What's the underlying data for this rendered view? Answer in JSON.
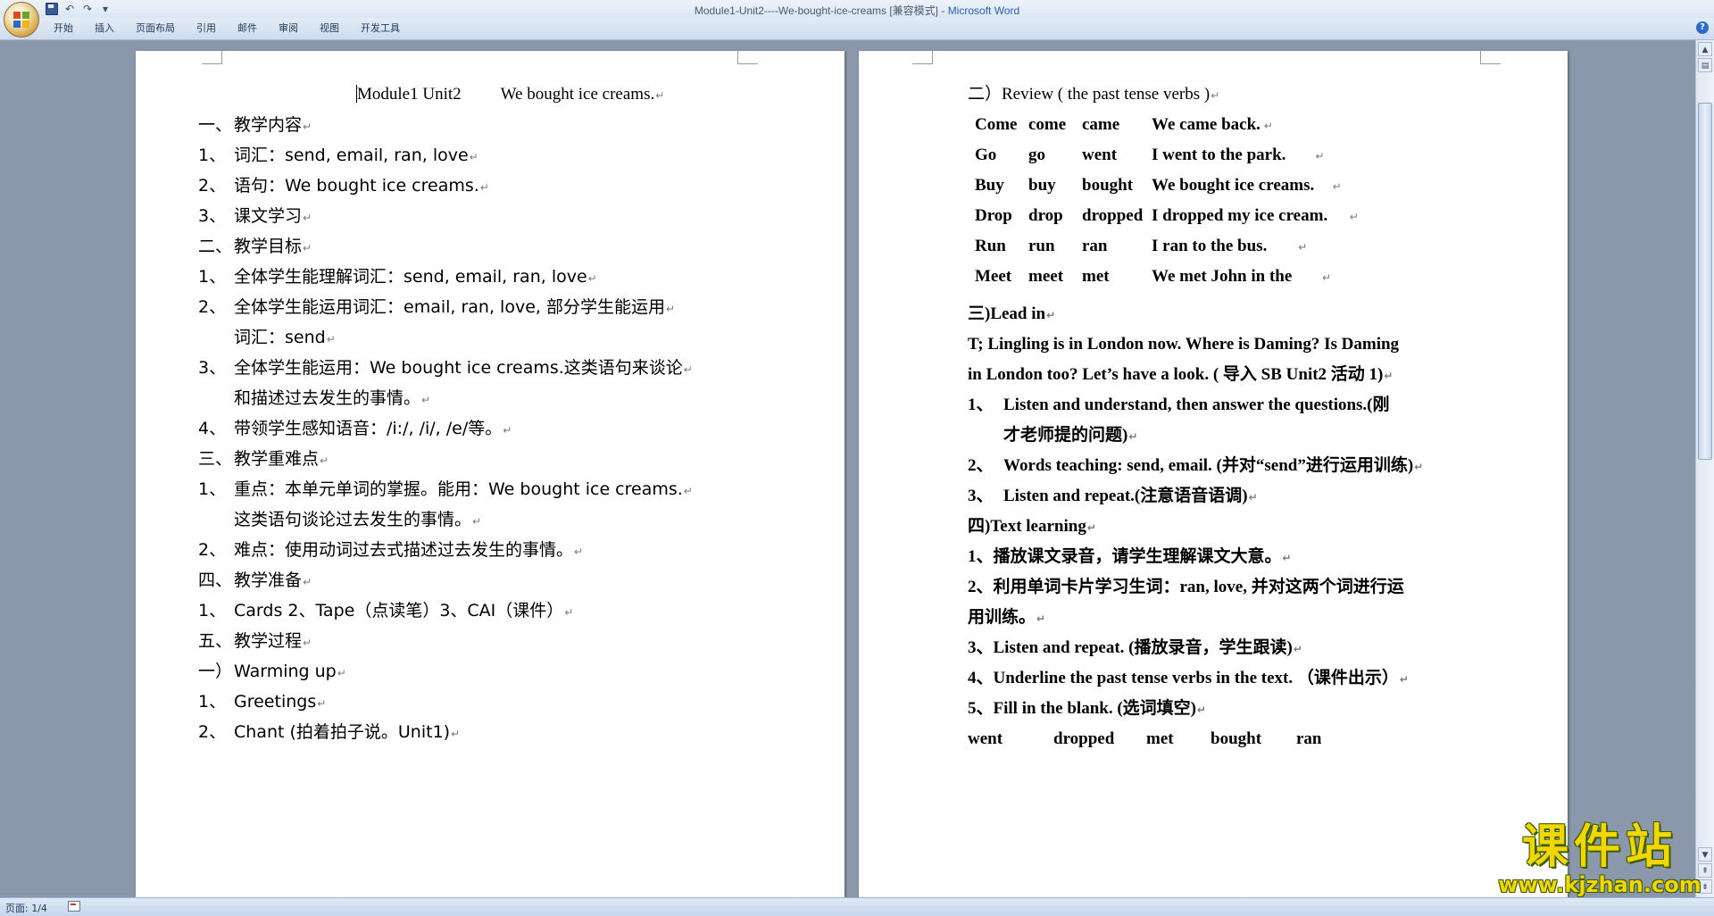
{
  "window": {
    "title_doc": "Module1-Unit2----We-bought-ice-creams [兼容模式] - ",
    "title_app": "Microsoft Word"
  },
  "quick_access": {
    "save_icon": "save-icon",
    "undo_glyph": "↶",
    "redo_glyph": "↷",
    "customize_glyph": "▾"
  },
  "ribbon": {
    "tabs": [
      "开始",
      "插入",
      "页面布局",
      "引用",
      "邮件",
      "审阅",
      "视图",
      "开发工具"
    ],
    "help_glyph": "?"
  },
  "page1": {
    "title_a": "Module1 Unit2",
    "title_b": "We bought ice creams.",
    "lines": [
      {
        "num": "一、",
        "text": "教学内容"
      },
      {
        "num": "1、",
        "text": "词汇：send, email, ran, love"
      },
      {
        "num": "2、",
        "text": "语句：We bought ice creams."
      },
      {
        "num": "3、",
        "text": "课文学习"
      },
      {
        "num": "二、",
        "text": "教学目标"
      },
      {
        "num": "1、",
        "text": "全体学生能理解词汇：send,  email, ran, love"
      },
      {
        "num": "2、",
        "text": "全体学生能运用词汇：email, ran, love,  部分学生能运用"
      },
      {
        "num": "",
        "text": "词汇：send"
      },
      {
        "num": "3、",
        "text": "全体学生能运用：We bought ice creams.这类语句来谈论"
      },
      {
        "num": "",
        "text": "和描述过去发生的事情。"
      },
      {
        "num": "4、",
        "text": "带领学生感知语音：/i:/, /i/, /e/等。"
      },
      {
        "num": "三、",
        "text": "教学重难点"
      },
      {
        "num": "1、",
        "text": "重点：本单元单词的掌握。能用：We bought ice creams."
      },
      {
        "num": "",
        "text": "这类语句谈论过去发生的事情。"
      },
      {
        "num": "2、",
        "text": "难点：使用动词过去式描述过去发生的事情。"
      },
      {
        "num": "四、",
        "text": "教学准备"
      },
      {
        "num": "1、",
        "text": "Cards    2、Tape（点读笔）3、CAI（课件）"
      },
      {
        "num": "五、",
        "text": "教学过程"
      },
      {
        "num": "一）",
        "text": "Warming up"
      },
      {
        "num": "1、",
        "text": "Greetings"
      },
      {
        "num": "2、",
        "text": "Chant (拍着拍子说。Unit1)"
      }
    ]
  },
  "page2": {
    "review_heading": "二）Review ( the past tense verbs )",
    "verbs": [
      {
        "a": "Come",
        "b": "come",
        "c": "came",
        "s": "We came back."
      },
      {
        "a": "Go",
        "b": "go",
        "c": "went",
        "s": "I went to the park."
      },
      {
        "a": "Buy",
        "b": "buy",
        "c": "bought",
        "s": "We bought ice creams."
      },
      {
        "a": "Drop",
        "b": "drop",
        "c": "dropped",
        "s": "I dropped my ice cream."
      },
      {
        "a": "Run",
        "b": "run",
        "c": "ran",
        "s": "I ran to the bus."
      },
      {
        "a": "Meet",
        "b": "meet",
        "c": "met",
        "s": "We met John in the "
      }
    ],
    "lead_in": "三)Lead in",
    "para_1": "T; Lingling is in London now. Where is Daming? Is Daming",
    "para_2": "in London too? Let’s have a look. (  导入 SB Unit2   活动 1)",
    "steps": [
      {
        "num": "1、",
        "text": "Listen  and  understand,  then  answer  the  questions.(刚"
      },
      {
        "num": "",
        "text": "才老师提的问题)"
      },
      {
        "num": "2、",
        "text": "Words teaching: send, email. (并对“send”进行运用训练)"
      },
      {
        "num": "3、",
        "text": "Listen and repeat.(注意语音语调)"
      }
    ],
    "text_learning": "四)Text learning",
    "tl_lines": [
      "1、播放课文录音，请学生理解课文大意。",
      "2、利用单词卡片学习生词：ran, love,  并对这两个词进行运",
      "用训练。",
      "3、Listen and repeat. (播放录音，学生跟读)",
      "4、Underline  the  past  tense  verbs  in  the  text.  （课件出示）",
      "5、Fill in the blank. (选词填空)"
    ],
    "blanks": [
      "went",
      "dropped",
      "met",
      "bought",
      "ran"
    ]
  },
  "status": {
    "page_indicator": "页面: 1/4"
  },
  "watermark": {
    "cn": "课件站",
    "url": "www.kjzhan.com"
  }
}
